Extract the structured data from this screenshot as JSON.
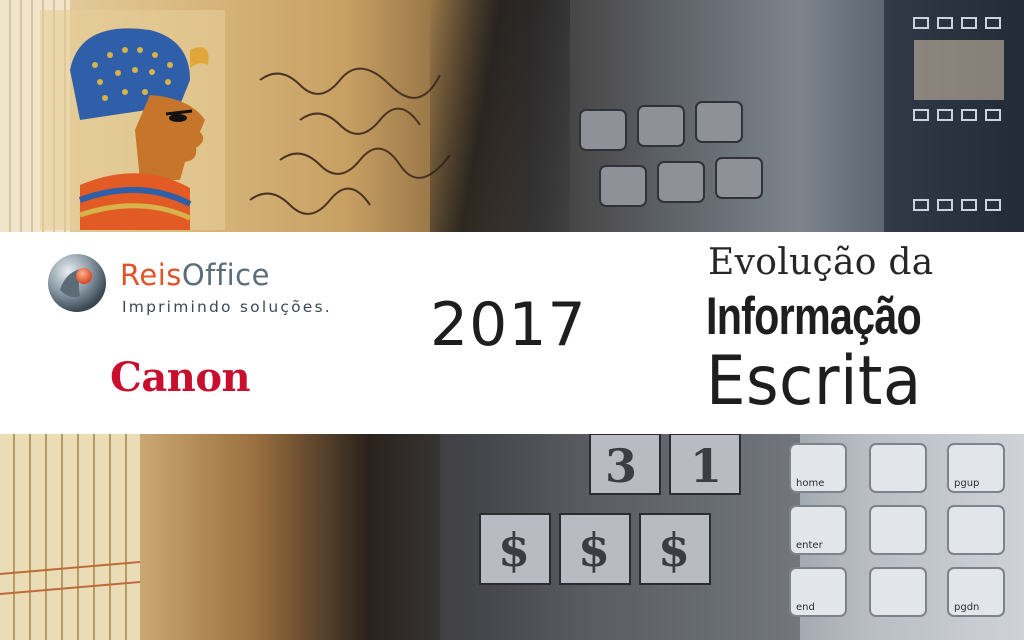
{
  "band": {
    "brand_name_part1": "Reis",
    "brand_name_part2": "Office",
    "brand_tagline": "Imprimindo soluções.",
    "partner_logo": "Canon",
    "year": "2017",
    "title_line1": "Evolução da",
    "title_line2": "Informação",
    "title_line3": "Escrita"
  },
  "keypad_labels": [
    "home",
    "pgup",
    "enter",
    "end",
    "pgdn"
  ],
  "type_glyphs": [
    "3",
    "1",
    "$",
    "$",
    "$"
  ],
  "colors": {
    "brand_gray": "#5c6c78",
    "brand_orange": "#e2532a",
    "canon_red": "#c8102e",
    "band_background": "#ffffff",
    "title_text": "#1e1e1e"
  },
  "icons": {
    "reis_logo_mark": "reisoffice-orb-icon"
  }
}
